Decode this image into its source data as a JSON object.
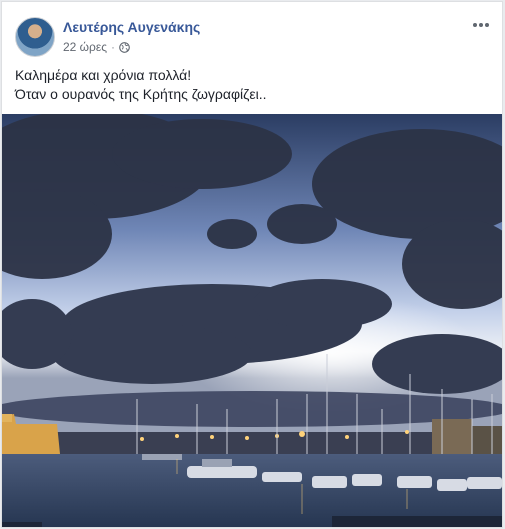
{
  "post": {
    "author": "Λευτέρης Αυγενάκης",
    "time": "22 ώρες",
    "separator": "·",
    "privacy_icon": "globe-icon",
    "more_icon": "more-options-icon",
    "text_lines": [
      "Καλημέρα και χρόνια πολλά!",
      "Όταν ο ουρανός της Κρήτης ζωγραφίζει.."
    ],
    "photo": {
      "subject": "harbor at dusk",
      "colors": {
        "sky_top": "#2d3f66",
        "sky_bottom": "#dfe6f3",
        "cloud": "#2c3346",
        "sea": "#2e4060",
        "fortress": "#d9a34a"
      }
    }
  },
  "theme": {
    "page_bg": "#e9ebee",
    "card_bg": "#ffffff",
    "link_color": "#385898",
    "text_color": "#1d2129",
    "meta_color": "#616770"
  }
}
